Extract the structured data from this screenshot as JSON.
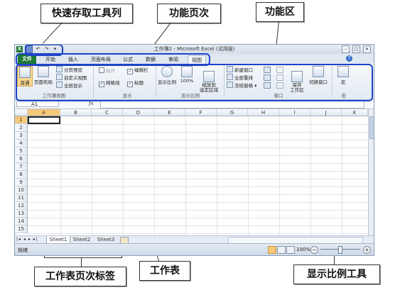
{
  "annotations": {
    "qat": "快速存取工具列",
    "tabs": "功能页次",
    "ribbon": "功能区",
    "sheet_tabs": "工作表页次标签",
    "worksheet": "工作表",
    "zoom_tool": "显示比例工具"
  },
  "window": {
    "title": "工作簿2 - Microsoft Excel (试用版)",
    "app_icon": "excel-icon"
  },
  "quick_access": {
    "save": "save-icon",
    "undo": "undo-icon",
    "redo": "redo-icon",
    "customize": "▾"
  },
  "tabs": [
    "文件",
    "开始",
    "插入",
    "页面布局",
    "公式",
    "数据",
    "审阅",
    "视图"
  ],
  "active_tab": "视图",
  "ribbon": {
    "groups": {
      "workbook_views": "工作簿视图",
      "show": "显示",
      "zoom": "显示比例",
      "window": "窗口",
      "macros": "宏"
    },
    "buttons": {
      "normal": "普通",
      "page_layout": "页面布局",
      "page_break": "分页预览",
      "custom_views": "自定义视图",
      "full_screen": "全屏显示",
      "ruler": "标尺",
      "formula_bar": "编辑栏",
      "gridlines": "网格线",
      "headings": "标题",
      "zoom": "显示比例",
      "zoom_100": "100%",
      "zoom_selection": "缩放到\n选定区域",
      "new_window": "新建窗口",
      "arrange_all": "全部重排",
      "freeze_panes": "冻结窗格",
      "save_workspace": "保存\n工作区",
      "switch_windows": "切换窗口",
      "macros": "宏"
    }
  },
  "formula_bar": {
    "name_box": "A1",
    "fx": "fx",
    "value": ""
  },
  "grid": {
    "columns": [
      "A",
      "B",
      "C",
      "D",
      "E",
      "F",
      "G",
      "H",
      "I",
      "J",
      "K"
    ],
    "rows": [
      "1",
      "2",
      "3",
      "4",
      "5",
      "6",
      "7",
      "8",
      "9",
      "10",
      "11",
      "12",
      "13",
      "14",
      "15"
    ],
    "selected_cell": "A1"
  },
  "sheets": [
    "Sheet1",
    "Sheet2",
    "Sheet3"
  ],
  "active_sheet": "Sheet1",
  "status": {
    "ready": "就绪",
    "zoom_level": "100%",
    "zoom_out": "−",
    "zoom_in": "+"
  },
  "colors": {
    "file_tab": "#1e7a36",
    "highlight_outline": "#1f44c9",
    "selected_row_header": "#f5c87a"
  }
}
